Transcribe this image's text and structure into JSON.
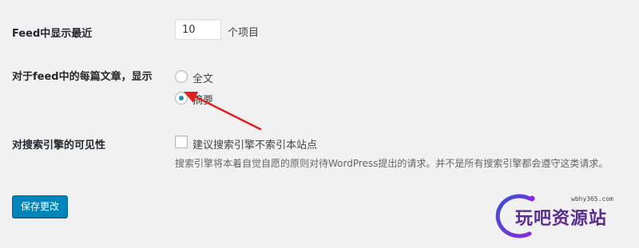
{
  "settings": {
    "feed_count": {
      "label": "Feed中显示最近",
      "value": "10",
      "suffix": "个项目"
    },
    "feed_article": {
      "label": "对于feed中的每篇文章，显示",
      "options": [
        {
          "label": "全文",
          "checked": false
        },
        {
          "label": "摘要",
          "checked": true
        }
      ]
    },
    "search_visibility": {
      "label": "对搜索引擎的可见性",
      "checkbox_label": "建议搜索引擎不索引本站点",
      "checked": false,
      "description": "搜索引擎将本着自觉自愿的原则对待WordPress提出的请求。并不是所有搜索引擎都会遵守这类请求。"
    }
  },
  "save_button": {
    "label": "保存更改"
  },
  "watermark": {
    "url": "wbhy365.com",
    "text": "玩吧资源站"
  },
  "colors": {
    "accent": "#0085ba",
    "radio_dot": "#1e8cbe",
    "arrow": "#e02020",
    "watermark": "#5b2d8e"
  }
}
